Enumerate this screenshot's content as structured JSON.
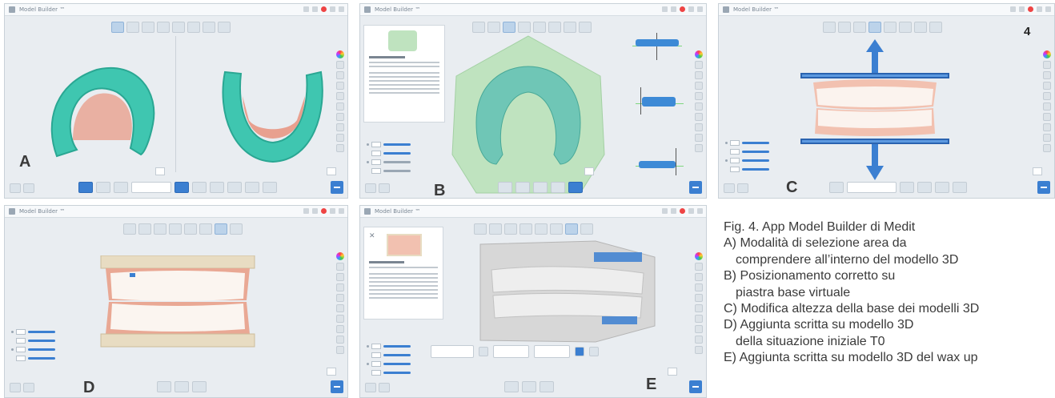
{
  "figure_number": "4",
  "caption": {
    "title": "Fig. 4. App Model Builder di Medit",
    "a_line1": "A) Modalità di selezione area da",
    "a_line2": "comprendere all’interno del modello 3D",
    "b_line1": "B) Posizionamento corretto su",
    "b_line2": "piastra base virtuale",
    "c_line1": "C) Modifica altezza della base dei modelli 3D",
    "d_line1": "D) Aggiunta scritta su modello 3D",
    "d_line2": "della situazione iniziale T0",
    "e_line1": "E) Aggiunta scritta su modello 3D del wax up"
  },
  "panels": {
    "a": {
      "label": "A",
      "title": "Model Builder ™"
    },
    "b": {
      "label": "B",
      "title": "Model Builder ™"
    },
    "c": {
      "label": "C",
      "title": "Model Builder ™"
    },
    "d": {
      "label": "D",
      "title": "Model Builder ™"
    },
    "e": {
      "label": "E",
      "title": "Model Builder ™"
    }
  },
  "colors": {
    "accent": "#3b7fd1",
    "model": "#3fc6b0",
    "gum": "#e8a08f",
    "base_plate": "#bfe3bf"
  }
}
